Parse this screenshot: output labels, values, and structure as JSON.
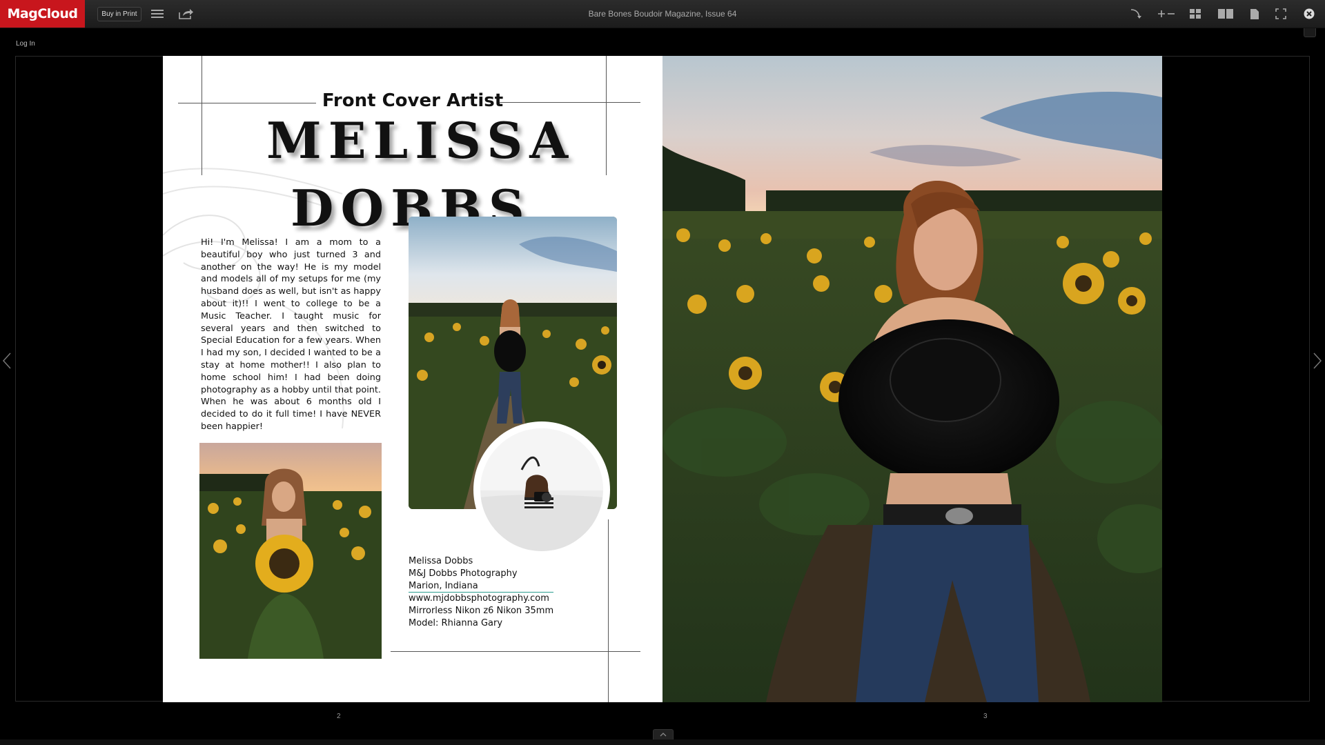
{
  "app": {
    "logo": "MagCloud",
    "buy_in_print": "Buy in Print",
    "title": "Bare Bones Boudoir Magazine, Issue 64",
    "login": "Log In"
  },
  "toolbar_icons": [
    "menu-icon",
    "share-icon",
    "rotate-icon",
    "zoom-icon",
    "grid-icon",
    "two-page-icon",
    "single-page-icon",
    "fullscreen-icon",
    "close-icon"
  ],
  "page_left": {
    "kicker": "Front Cover Artist",
    "name_line1": "MELISSA",
    "name_line2": "DOBBS",
    "bio": "Hi! I'm Melissa! I am a mom to a beautiful boy who just turned 3 and another on the way! He is my model and models all of my setups for me (my husband does as well, but isn't as happy about it)!! I went to college to be a Music Teacher. I taught music for several years and then switched to Special Education for a few years. When I had my son, I decided I wanted to be a stay at home mother!! I also plan to home school him! I had been doing photography as a hobby until that point. When he was about 6 months old I decided to do it full time! I have NEVER been happier!",
    "credits": {
      "line1": "Melissa Dobbs",
      "line2": "M&J Dobbs Photography",
      "line3": "Marion, Indiana",
      "line4": "www.mjdobbsphotography.com",
      "line5": "Mirrorless Nikon z6 Nikon 35mm",
      "line6": "Model: Rhianna Gary"
    }
  },
  "page_numbers": {
    "left": "2",
    "right": "3"
  },
  "colors": {
    "brand": "#c8161d",
    "background": "#000000",
    "accent_underline": "#2a9d8f"
  }
}
